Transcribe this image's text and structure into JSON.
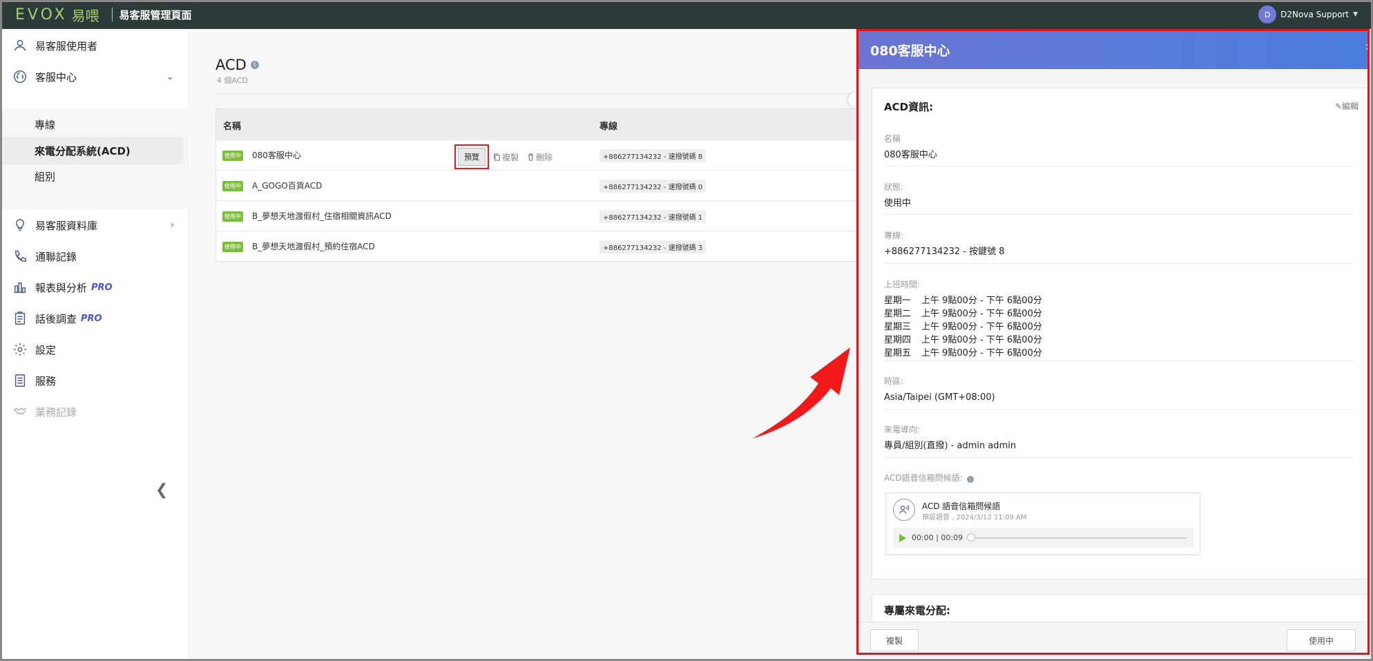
{
  "header": {
    "logo_text": "EVOX",
    "logo_cn": "易喂",
    "title": "易客服管理頁面",
    "user_initial": "D",
    "user_name": "D2Nova Support"
  },
  "sidebar": {
    "items": [
      {
        "label": "易客服使用者",
        "icon": "user-icon"
      },
      {
        "label": "客服中心",
        "icon": "headset-icon"
      },
      {
        "label": "易客服資料庫",
        "icon": "lightbulb-icon"
      },
      {
        "label": "通聯記錄",
        "icon": "phone-log-icon"
      },
      {
        "label": "報表與分析",
        "icon": "bar-chart-icon",
        "pro": "PRO"
      },
      {
        "label": "話後調查",
        "icon": "survey-icon",
        "pro": "PRO"
      },
      {
        "label": "設定",
        "icon": "gear-icon"
      },
      {
        "label": "服務",
        "icon": "service-list-icon"
      },
      {
        "label": "業務記錄",
        "icon": "handshake-icon"
      }
    ],
    "sub_items": [
      {
        "label": "專線"
      },
      {
        "label": "來電分配系統(ACD)"
      },
      {
        "label": "組別"
      }
    ]
  },
  "main": {
    "title": "ACD",
    "subtitle": "4 個ACD",
    "columns": {
      "name": "名稱",
      "line": "專線"
    },
    "rows": [
      {
        "status": "使用中",
        "name": "080客服中心",
        "line": "+886277134232 - 速撥號碼 8"
      },
      {
        "status": "使用中",
        "name": "A_GOGO百貨ACD",
        "line": "+886277134232 - 速撥號碼 0"
      },
      {
        "status": "使用中",
        "name": "B_夢想天地渡假村_住宿相關資訊ACD",
        "line": "+886277134232 - 速撥號碼 1"
      },
      {
        "status": "使用中",
        "name": "B_夢想天地渡假村_預約住宿ACD",
        "line": "+886277134232 - 速撥號碼 3"
      }
    ],
    "actions": {
      "preview": "預覽",
      "copy": "複製",
      "delete": "刪除"
    }
  },
  "panel": {
    "title": "080客服中心",
    "card_title": "ACD資訊:",
    "edit": "編輯",
    "fields": {
      "name_label": "名稱",
      "name_value": "080客服中心",
      "status_label": "狀態:",
      "status_value": "使用中",
      "line_label": "專線:",
      "line_value": "+886277134232 - 按鍵號 8",
      "hours_label": "上班時間:",
      "schedule": [
        {
          "day": "星期一",
          "time": "上午 9點00分 - 下午 6點00分"
        },
        {
          "day": "星期二",
          "time": "上午 9點00分 - 下午 6點00分"
        },
        {
          "day": "星期三",
          "time": "上午 9點00分 - 下午 6點00分"
        },
        {
          "day": "星期四",
          "time": "上午 9點00分 - 下午 6點00分"
        },
        {
          "day": "星期五",
          "time": "上午 9點00分 - 下午 6點00分"
        }
      ],
      "tz_label": "時區:",
      "tz_value": "Asia/Taipei (GMT+08:00)",
      "route_label": "來電導向:",
      "route_value": "專員/組別(直撥) - admin admin",
      "greeting_label": "ACD語音信箱問候語:"
    },
    "audio": {
      "title": "ACD 語音信箱問候語",
      "subtitle": "預設語音 , 2024/3/12 11:09 AM",
      "time": "00:00 | 00:09",
      "progress": 0
    },
    "card2_title": "專屬來電分配:",
    "footer": {
      "copy": "複製",
      "status": "使用中"
    }
  },
  "colors": {
    "accent": "#4a55c9",
    "status_green": "#7cbd3b",
    "highlight_red": "#e0141b"
  }
}
